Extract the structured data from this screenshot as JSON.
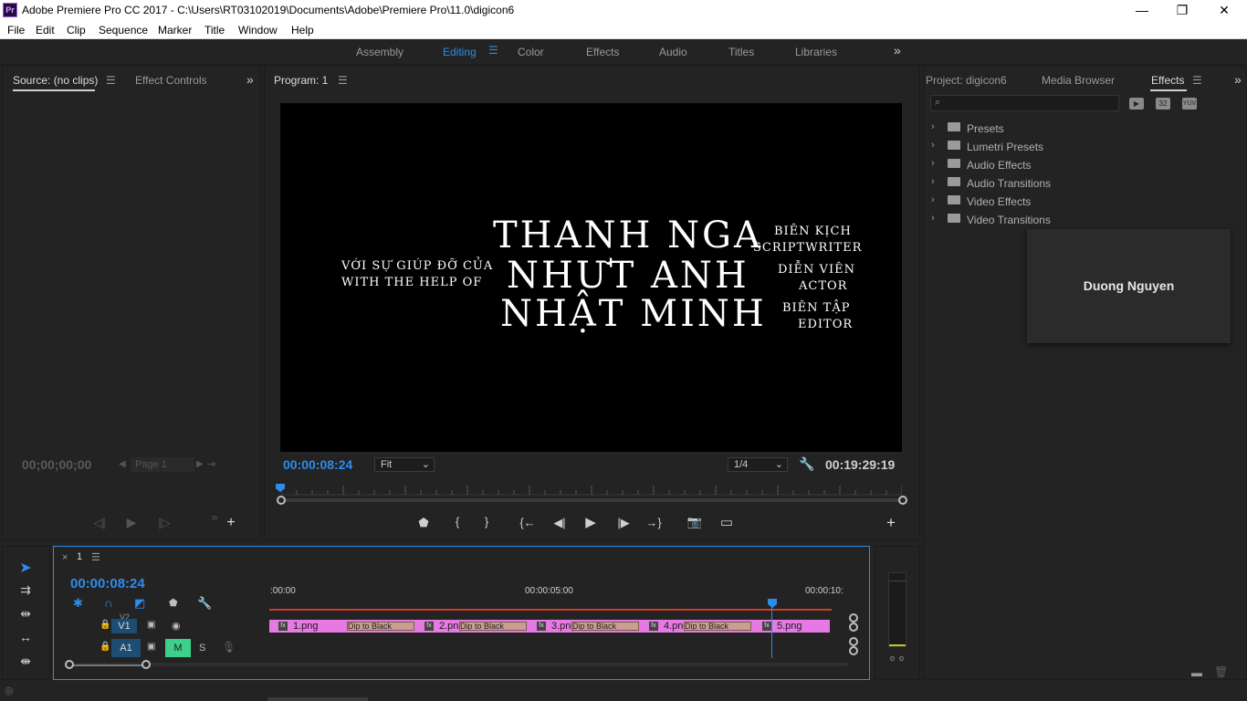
{
  "window": {
    "app_logo": "Pr",
    "title": "Adobe Premiere Pro CC 2017 - C:\\Users\\RT03102019\\Documents\\Adobe\\Premiere Pro\\11.0\\digicon6",
    "minimize": "—",
    "maximize": "❐",
    "close": "✕"
  },
  "menu": [
    "File",
    "Edit",
    "Clip",
    "Sequence",
    "Marker",
    "Title",
    "Window",
    "Help"
  ],
  "workspaces": {
    "tabs": [
      "Assembly",
      "Editing",
      "Color",
      "Effects",
      "Audio",
      "Titles",
      "Libraries"
    ],
    "active": "Editing",
    "overflow": "»"
  },
  "source_panel": {
    "tabs": [
      "Source: (no clips)",
      "Effect Controls"
    ],
    "timecode": "00;00;00;00",
    "page": "Page 1"
  },
  "program_panel": {
    "tab": "Program: 1",
    "timecode_current": "00:00:08:24",
    "fit": "Fit",
    "resolution": "1/4",
    "timecode_duration": "00:19:29:19",
    "video_text": {
      "left_line1": "VỚI SỰ GIÚP ĐỠ CỦA",
      "left_line2": "WITH THE HELP OF",
      "name1": "THANH NGA",
      "name2": "NHƯT ANH",
      "name3": "NHẬT MINH",
      "role1a": "BIÊN KỊCH",
      "role1b": "SCRIPTWRITER",
      "role2a": "DIỄN VIÊN",
      "role2b": "ACTOR",
      "role3a": "BIÊN TẬP",
      "role3b": "EDITOR"
    }
  },
  "project_panel": {
    "tabs": [
      "Project: digicon6",
      "Media Browser",
      "Effects"
    ],
    "active_tab": "Effects",
    "effects_badges": [
      "32",
      "YUV"
    ],
    "folders": [
      "Presets",
      "Lumetri Presets",
      "Audio Effects",
      "Audio Transitions",
      "Video Effects",
      "Video Transitions"
    ],
    "overlay_text": "Duong Nguyen"
  },
  "timeline": {
    "sequence_name": "1",
    "timecode": "00:00:08:24",
    "ruler": [
      ":00:00",
      "00:00:05:00",
      "00:00:10:"
    ],
    "tracks": {
      "v2": "V2",
      "v1": "V1",
      "a1": "A1",
      "mute": "M",
      "solo": "S"
    },
    "clips": [
      "1.png",
      "2.png",
      "3.png",
      "4.png",
      "5.png"
    ],
    "transition_label": "Dip to Black"
  },
  "colors": {
    "accent_blue": "#2d8ceb",
    "clip_pink": "#e779e4",
    "transition_tan": "#c9a08e",
    "work_area_red": "#d23b2b"
  },
  "icons": {
    "search": "search-icon",
    "wrench": "wrench-icon",
    "camera": "camera-icon",
    "play": "play-icon",
    "folder": "folder-icon",
    "selection_tool": "selection-tool-icon"
  }
}
